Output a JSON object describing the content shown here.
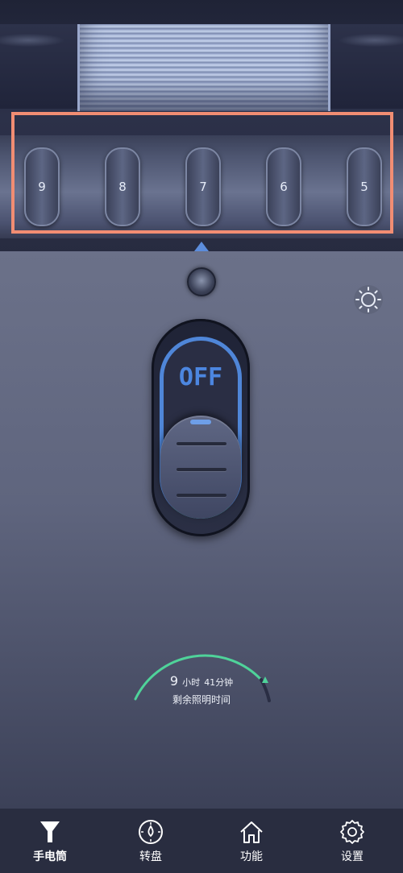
{
  "dial": {
    "numbers": [
      "9",
      "8",
      "7",
      "6",
      "5"
    ]
  },
  "switch": {
    "state_label": "OFF"
  },
  "remaining": {
    "hours": "9",
    "hours_unit": "小时",
    "minutes": "41",
    "minutes_unit": "分钟",
    "caption": "剩余照明时间"
  },
  "tabs": [
    {
      "label": "手电筒",
      "icon": "flashlight-icon"
    },
    {
      "label": "转盘",
      "icon": "dial-icon"
    },
    {
      "label": "功能",
      "icon": "home-icon"
    },
    {
      "label": "设置",
      "icon": "gear-icon"
    }
  ],
  "colors": {
    "accent_blue": "#4c86e0",
    "accent_green": "#4fd39a",
    "highlight": "#f18d73"
  }
}
